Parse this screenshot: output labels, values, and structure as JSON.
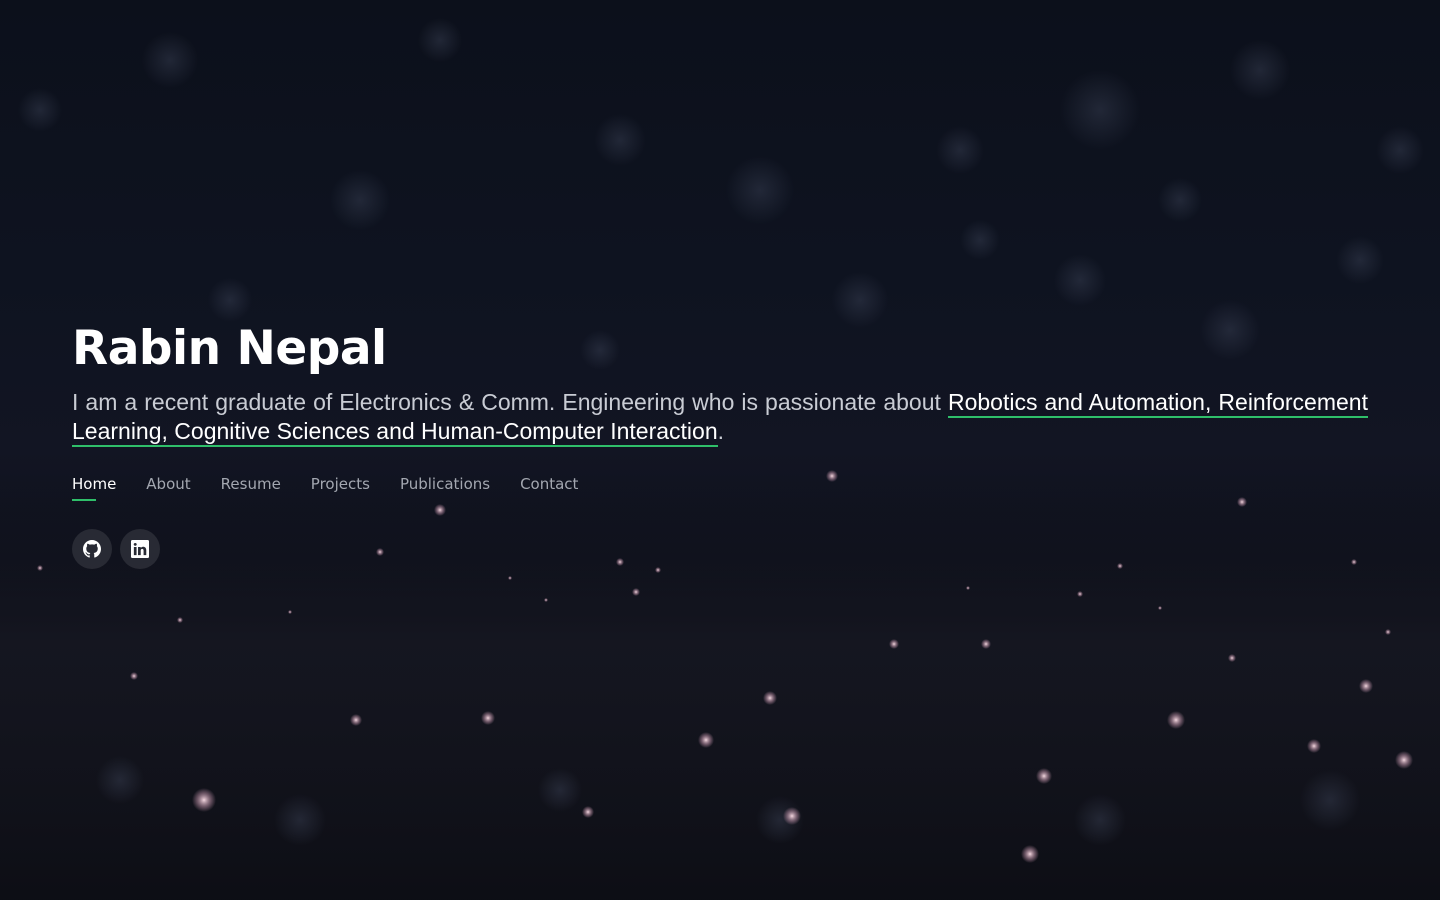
{
  "hero": {
    "name": "Rabin Nepal",
    "intro_prefix": "I am a recent graduate of Electronics & Comm. Engineering who is passionate about ",
    "intro_highlight": "Robotics and Automation, Reinforcement Learning, Cognitive Sciences and Human-Computer Interaction",
    "intro_suffix": "."
  },
  "nav": {
    "items": [
      {
        "label": "Home",
        "active": true
      },
      {
        "label": "About"
      },
      {
        "label": "Resume"
      },
      {
        "label": "Projects"
      },
      {
        "label": "Publications"
      },
      {
        "label": "Contact"
      }
    ]
  },
  "social": {
    "items": [
      {
        "icon": "github-icon"
      },
      {
        "icon": "linkedin-icon"
      }
    ]
  },
  "colors": {
    "accent": "#2fbf6a",
    "background": "#0b0d16",
    "text": "#ffffff",
    "muted_text": "#c9ccd4"
  }
}
